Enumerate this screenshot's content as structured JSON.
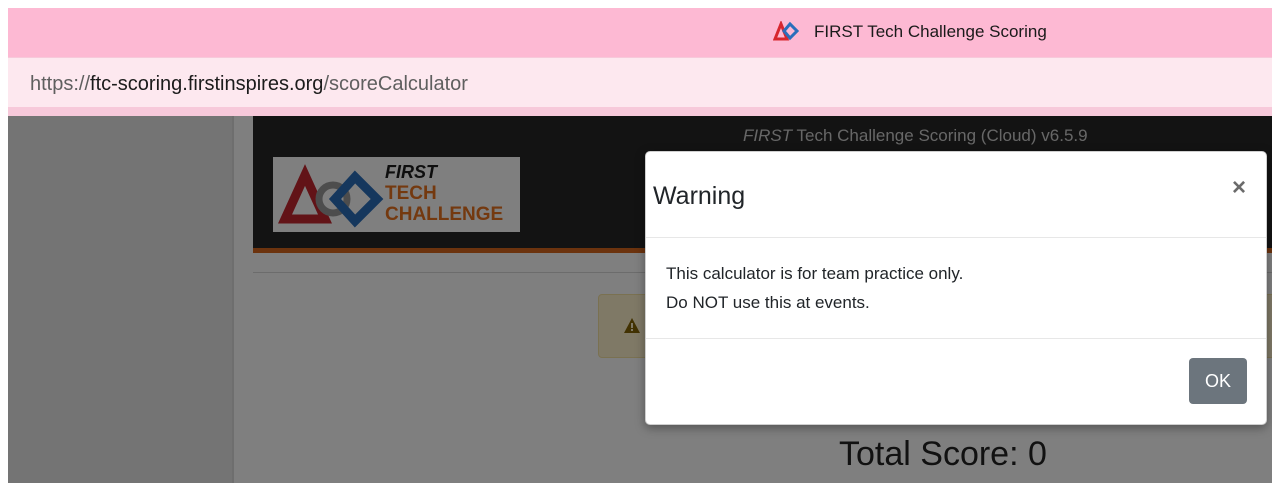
{
  "browser": {
    "tab_title": "FIRST Tech Challenge Scoring",
    "url_scheme": "https://",
    "url_host": "ftc-scoring.firstinspires.org",
    "url_path": "/scoreCalculator"
  },
  "header": {
    "title_first": "FIRST",
    "title_rest": " Tech Challenge Scoring (Cloud) v6.5.9",
    "logo_words": [
      "FIRST",
      "TECH",
      "CHALLENGE"
    ]
  },
  "main": {
    "total_score_label": "Total Score: 0"
  },
  "modal": {
    "title": "Warning",
    "close_glyph": "×",
    "body_lines": [
      "This calculator is for team practice only.",
      "Do NOT use this at events."
    ],
    "ok_label": "OK"
  },
  "colors": {
    "tab_bar": "#fdb9d3",
    "address_bar": "#fde8ef",
    "header_bg": "#262626",
    "header_stripe": "#d9661c",
    "logo_orange": "#e8731f",
    "ok_button": "#6c757d"
  }
}
